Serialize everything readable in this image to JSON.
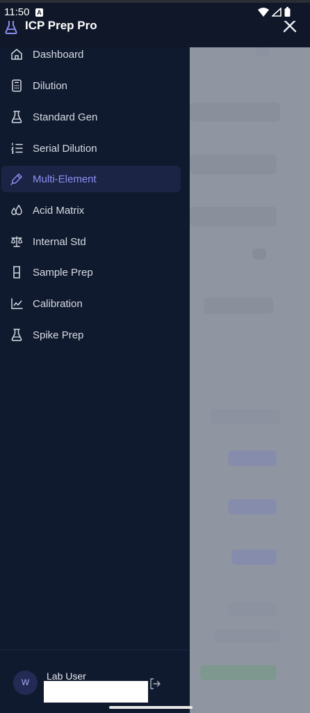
{
  "status_bar": {
    "time": "11:50",
    "notification_badge": "A",
    "icons": [
      "wifi-icon",
      "signal-icon",
      "battery-icon"
    ]
  },
  "header": {
    "title": "ICP Prep Pro",
    "logo_icon": "flask-icon",
    "close_icon": "close-icon"
  },
  "nav": {
    "items": [
      {
        "label": "Dashboard",
        "icon": "home-icon",
        "active": false
      },
      {
        "label": "Dilution",
        "icon": "calculator-icon",
        "active": false
      },
      {
        "label": "Standard Gen",
        "icon": "flask-icon",
        "active": false
      },
      {
        "label": "Serial Dilution",
        "icon": "list-ordered-icon",
        "active": false
      },
      {
        "label": "Multi-Element",
        "icon": "pipette-icon",
        "active": true
      },
      {
        "label": "Acid Matrix",
        "icon": "droplets-icon",
        "active": false
      },
      {
        "label": "Internal Std",
        "icon": "scale-icon",
        "active": false
      },
      {
        "label": "Sample Prep",
        "icon": "beaker-icon",
        "active": false
      },
      {
        "label": "Calibration",
        "icon": "chart-line-icon",
        "active": false
      },
      {
        "label": "Spike Prep",
        "icon": "flask-icon",
        "active": false
      }
    ]
  },
  "user": {
    "avatar_initial": "W",
    "name": "Lab User",
    "logout_icon": "logout-icon"
  },
  "colors": {
    "background": "#0f1729",
    "drawer": "#101a2e",
    "active_bg": "#1c2445",
    "active_text": "#8b8ff2",
    "text": "#d6dbe4",
    "overlay": "#9096a1"
  }
}
